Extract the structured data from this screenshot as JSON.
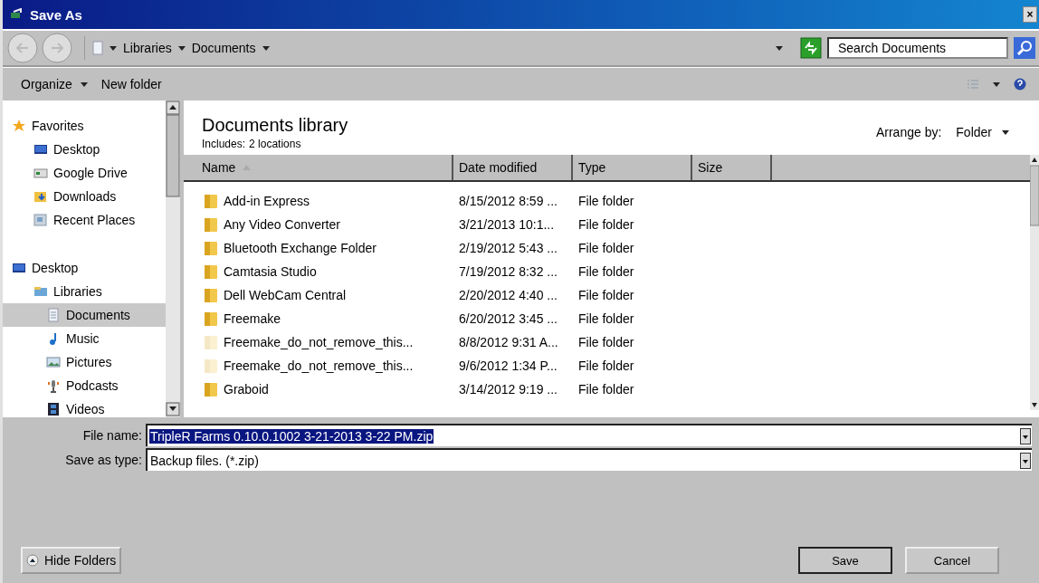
{
  "window": {
    "title": "Save As",
    "close": "×"
  },
  "address": {
    "crumbs": [
      "Libraries",
      "Documents"
    ]
  },
  "search": {
    "placeholder": "Search Documents"
  },
  "toolbar": {
    "organize": "Organize",
    "new_folder": "New folder"
  },
  "sidebar": {
    "groups": [
      {
        "label": "Favorites",
        "kind": "star",
        "selected": false,
        "children": [
          {
            "label": "Desktop",
            "kind": "monitor",
            "selected": false
          },
          {
            "label": "Google Drive",
            "kind": "drive",
            "selected": false
          },
          {
            "label": "Downloads",
            "kind": "download",
            "selected": false
          },
          {
            "label": "Recent Places",
            "kind": "recent",
            "selected": false
          }
        ]
      },
      {
        "label": "Desktop",
        "kind": "monitor",
        "selected": false,
        "children": [
          {
            "label": "Libraries",
            "kind": "library",
            "selected": false,
            "children": [
              {
                "label": "Documents",
                "kind": "document",
                "selected": true
              },
              {
                "label": "Music",
                "kind": "music",
                "selected": false
              },
              {
                "label": "Pictures",
                "kind": "picture",
                "selected": false
              },
              {
                "label": "Podcasts",
                "kind": "podcast",
                "selected": false
              },
              {
                "label": "Videos",
                "kind": "video",
                "selected": false
              }
            ]
          }
        ]
      }
    ]
  },
  "library": {
    "title": "Documents library",
    "includes_label": "Includes:",
    "includes_value": "2 locations",
    "arrange_label": "Arrange by:",
    "arrange_value": "Folder"
  },
  "table": {
    "columns": [
      {
        "label": "Name",
        "sorted": true
      },
      {
        "label": "Date modified",
        "sorted": false
      },
      {
        "label": "Type",
        "sorted": false
      },
      {
        "label": "Size",
        "sorted": false
      }
    ],
    "rows": [
      {
        "name": "Add-in Express",
        "date": "8/15/2012 8:59 ...",
        "type": "File folder",
        "hidden": false
      },
      {
        "name": "Any Video Converter",
        "date": "3/21/2013 10:1...",
        "type": "File folder",
        "hidden": false
      },
      {
        "name": "Bluetooth Exchange Folder",
        "date": "2/19/2012 5:43 ...",
        "type": "File folder",
        "hidden": false
      },
      {
        "name": "Camtasia Studio",
        "date": "7/19/2012 8:32 ...",
        "type": "File folder",
        "hidden": false
      },
      {
        "name": "Dell WebCam Central",
        "date": "2/20/2012 4:40 ...",
        "type": "File folder",
        "hidden": false
      },
      {
        "name": "Freemake",
        "date": "6/20/2012 3:45 ...",
        "type": "File folder",
        "hidden": false
      },
      {
        "name": "Freemake_do_not_remove_this...",
        "date": "8/8/2012 9:31 A...",
        "type": "File folder",
        "hidden": true
      },
      {
        "name": "Freemake_do_not_remove_this...",
        "date": "9/6/2012 1:34 P...",
        "type": "File folder",
        "hidden": true
      },
      {
        "name": "Graboid",
        "date": "3/14/2012 9:19 ...",
        "type": "File folder",
        "hidden": false
      }
    ]
  },
  "file_name": {
    "label": "File name:",
    "value": "TripleR Farms 0.10.0.1002 3-21-2013 3-22 PM.zip",
    "selected": true
  },
  "save_type": {
    "label": "Save as type:",
    "value": "Backup files. (*.zip)"
  },
  "buttons": {
    "hide_folders": "Hide Folders",
    "save": "Save",
    "cancel": "Cancel"
  }
}
